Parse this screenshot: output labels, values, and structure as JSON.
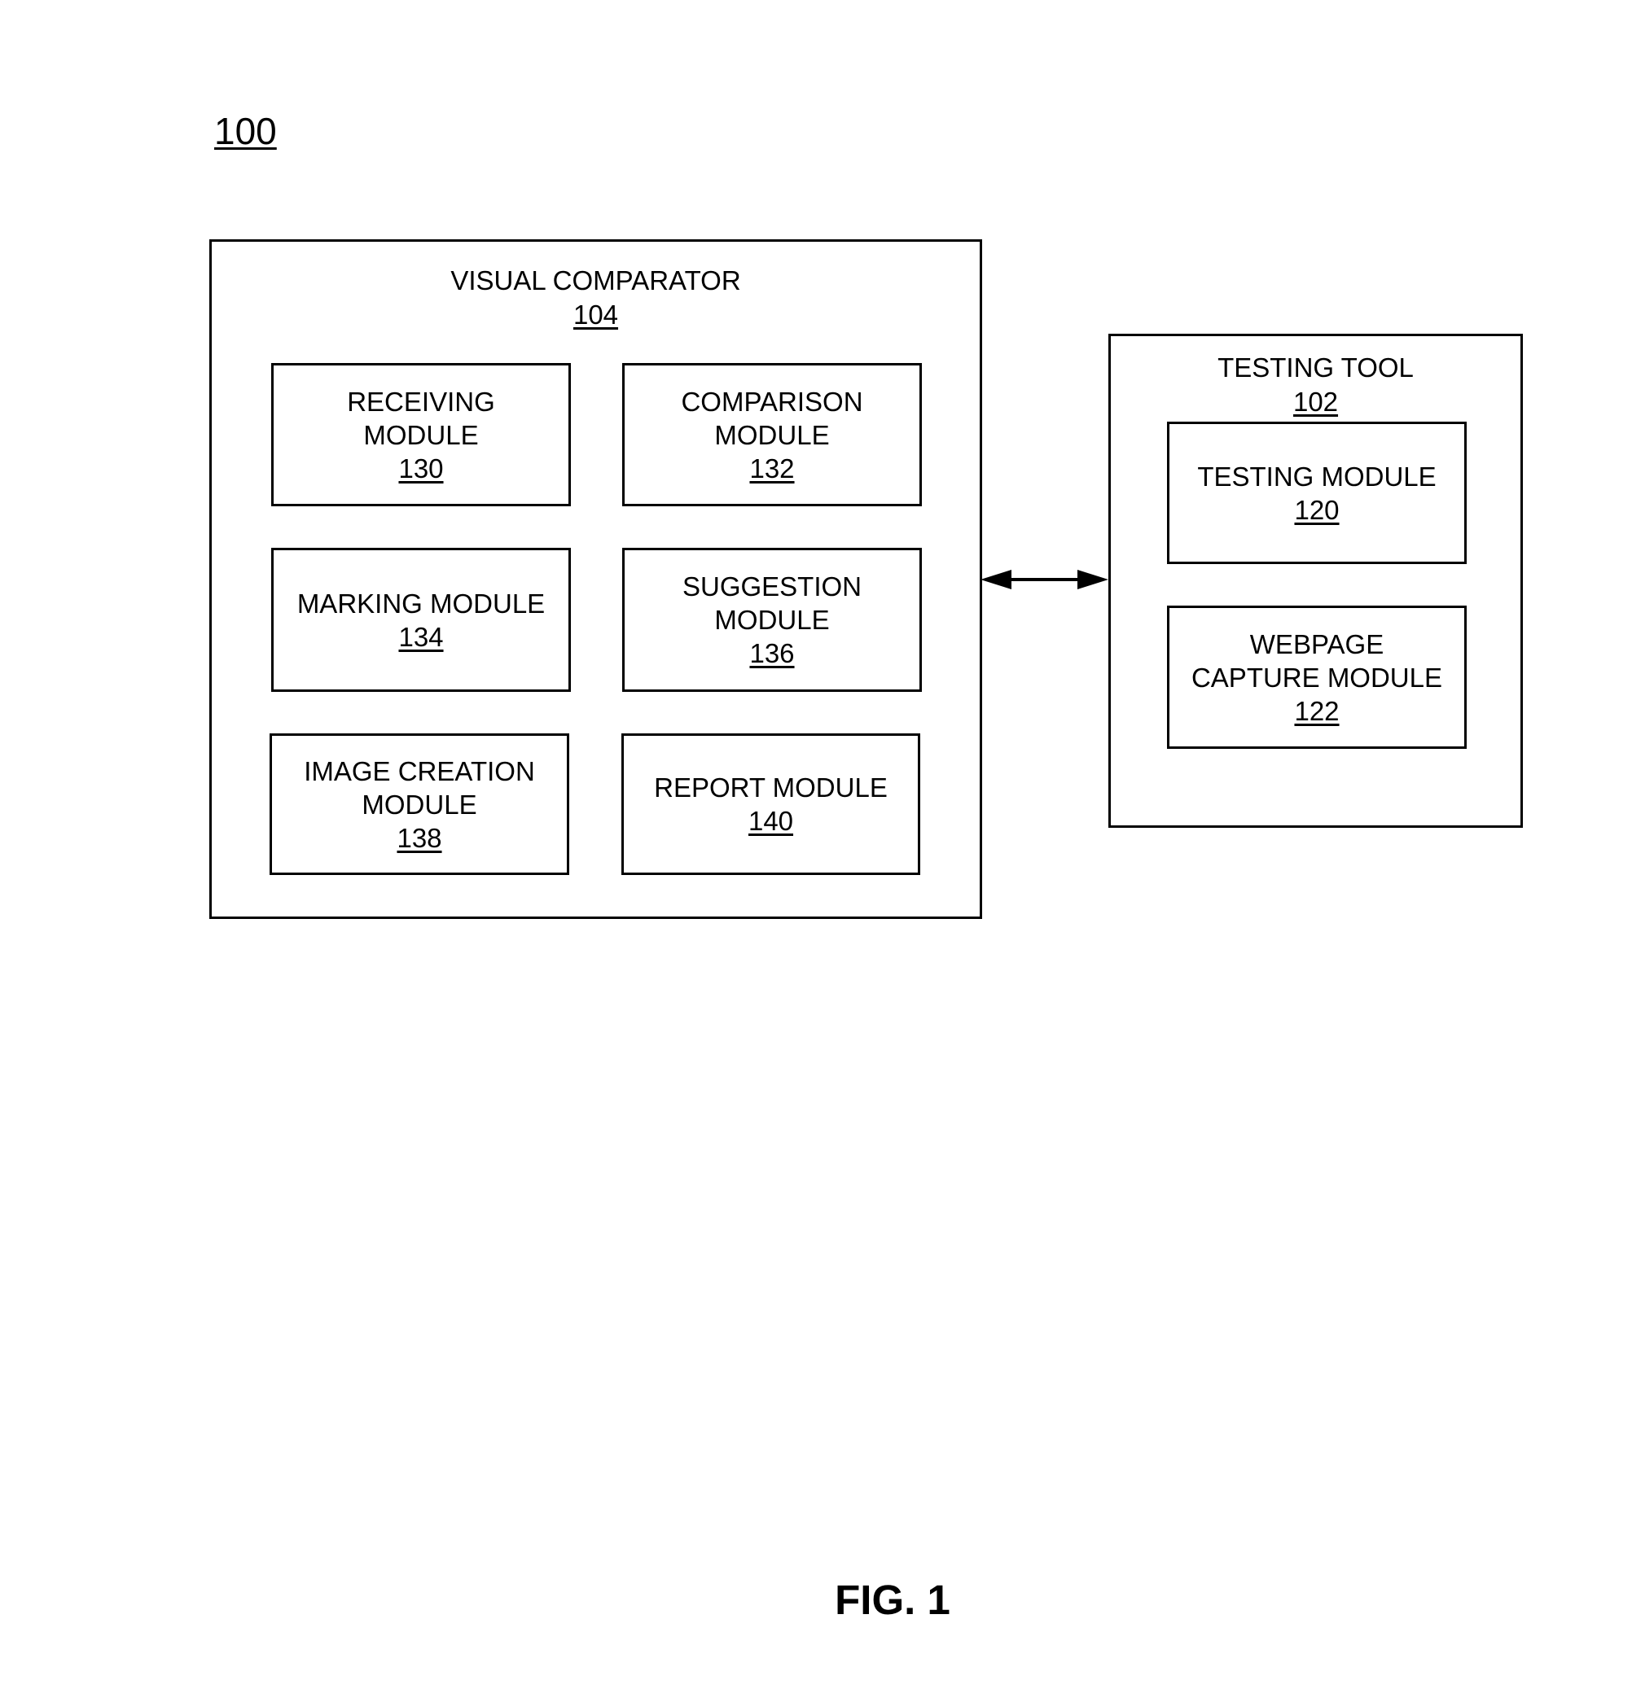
{
  "figure": {
    "reference_number": "100",
    "caption": "FIG. 1"
  },
  "visual_comparator": {
    "title": "VISUAL COMPARATOR",
    "reference_number": "104",
    "modules": [
      {
        "name": "RECEIVING\nMODULE",
        "reference_number": "130"
      },
      {
        "name": "COMPARISON\nMODULE",
        "reference_number": "132"
      },
      {
        "name": "MARKING MODULE",
        "reference_number": "134"
      },
      {
        "name": "SUGGESTION\nMODULE",
        "reference_number": "136"
      },
      {
        "name": "IMAGE CREATION\nMODULE",
        "reference_number": "138"
      },
      {
        "name": "REPORT MODULE",
        "reference_number": "140"
      }
    ]
  },
  "testing_tool": {
    "title": "TESTING TOOL",
    "reference_number": "102",
    "modules": [
      {
        "name": "TESTING MODULE",
        "reference_number": "120"
      },
      {
        "name": "WEBPAGE\nCAPTURE MODULE",
        "reference_number": "122"
      }
    ]
  },
  "connections": [
    {
      "from": "VISUAL COMPARATOR",
      "to": "TESTING TOOL",
      "type": "bidirectional-arrow"
    }
  ]
}
